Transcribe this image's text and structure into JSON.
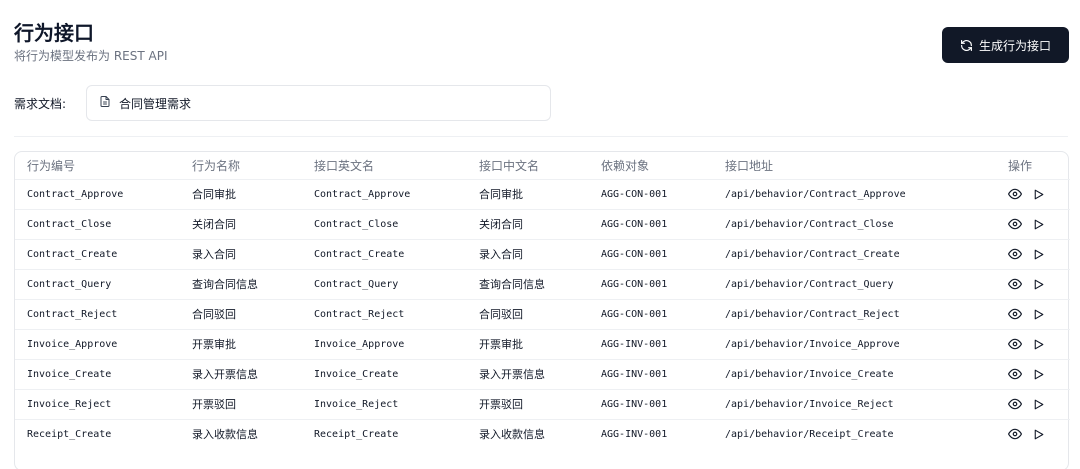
{
  "header": {
    "title": "行为接口",
    "subtitle": "将行为模型发布为 REST API"
  },
  "toolbar": {
    "generate_label": "生成行为接口"
  },
  "requirement": {
    "label": "需求文档:",
    "value": "合同管理需求"
  },
  "table": {
    "columns": [
      "行为编号",
      "行为名称",
      "接口英文名",
      "接口中文名",
      "依赖对象",
      "接口地址",
      "操作"
    ],
    "rows": [
      {
        "id": "Contract_Approve",
        "name": "合同审批",
        "en": "Contract_Approve",
        "cn": "合同审批",
        "dep": "AGG-CON-001",
        "url": "/api/behavior/Contract_Approve"
      },
      {
        "id": "Contract_Close",
        "name": "关闭合同",
        "en": "Contract_Close",
        "cn": "关闭合同",
        "dep": "AGG-CON-001",
        "url": "/api/behavior/Contract_Close"
      },
      {
        "id": "Contract_Create",
        "name": "录入合同",
        "en": "Contract_Create",
        "cn": "录入合同",
        "dep": "AGG-CON-001",
        "url": "/api/behavior/Contract_Create"
      },
      {
        "id": "Contract_Query",
        "name": "查询合同信息",
        "en": "Contract_Query",
        "cn": "查询合同信息",
        "dep": "AGG-CON-001",
        "url": "/api/behavior/Contract_Query"
      },
      {
        "id": "Contract_Reject",
        "name": "合同驳回",
        "en": "Contract_Reject",
        "cn": "合同驳回",
        "dep": "AGG-CON-001",
        "url": "/api/behavior/Contract_Reject"
      },
      {
        "id": "Invoice_Approve",
        "name": "开票审批",
        "en": "Invoice_Approve",
        "cn": "开票审批",
        "dep": "AGG-INV-001",
        "url": "/api/behavior/Invoice_Approve"
      },
      {
        "id": "Invoice_Create",
        "name": "录入开票信息",
        "en": "Invoice_Create",
        "cn": "录入开票信息",
        "dep": "AGG-INV-001",
        "url": "/api/behavior/Invoice_Create"
      },
      {
        "id": "Invoice_Reject",
        "name": "开票驳回",
        "en": "Invoice_Reject",
        "cn": "开票驳回",
        "dep": "AGG-INV-001",
        "url": "/api/behavior/Invoice_Reject"
      },
      {
        "id": "Receipt_Create",
        "name": "录入收款信息",
        "en": "Receipt_Create",
        "cn": "录入收款信息",
        "dep": "AGG-INV-001",
        "url": "/api/behavior/Receipt_Create"
      }
    ],
    "row_actions": [
      "eye-icon",
      "play-icon"
    ]
  }
}
